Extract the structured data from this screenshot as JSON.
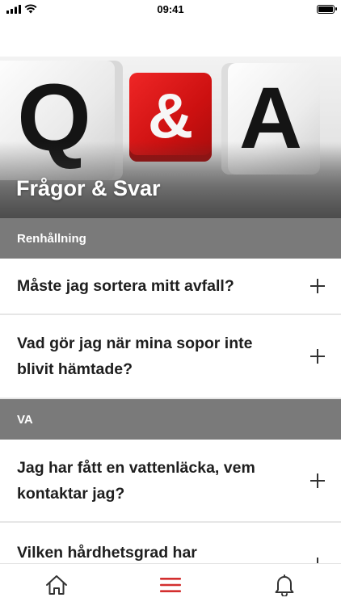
{
  "status_bar": {
    "time": "09:41"
  },
  "hero": {
    "title": "Frågor & Svar",
    "image_letters": {
      "q": "Q",
      "amp": "&",
      "a": "A"
    }
  },
  "colors": {
    "section_header_bg": "#7a7a7a",
    "accent_red": "#d32f2f",
    "text_dark": "#1e1e1e"
  },
  "sections": [
    {
      "title": "Renhållning",
      "items": [
        {
          "question": "Måste jag sortera mitt avfall?",
          "icon": "plus-icon"
        },
        {
          "question": "Vad gör jag när mina sopor inte blivit hämtade?",
          "icon": "plus-icon"
        }
      ]
    },
    {
      "title": "VA",
      "items": [
        {
          "question": "Jag har fått en vattenläcka, vem kontaktar jag?",
          "icon": "plus-icon"
        },
        {
          "question": "Vilken hårdhetsgrad har",
          "icon": "plus-icon"
        }
      ]
    }
  ],
  "tab_bar": {
    "tabs": [
      {
        "name": "home",
        "icon": "home-icon",
        "active": false
      },
      {
        "name": "menu",
        "icon": "menu-icon",
        "active": true
      },
      {
        "name": "notifications",
        "icon": "bell-icon",
        "active": false
      }
    ]
  }
}
